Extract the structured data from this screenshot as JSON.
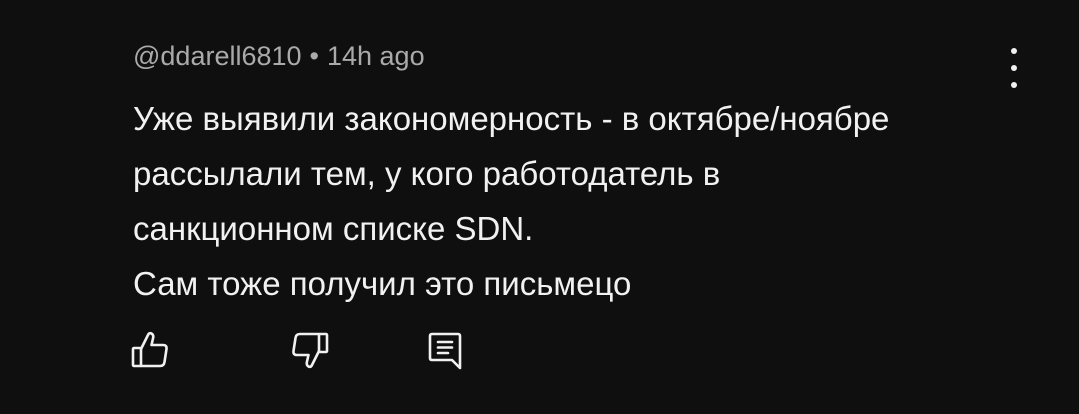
{
  "comment": {
    "author": "@ddarell6810",
    "separator": "•",
    "time": "14h ago",
    "lines": [
      "Уже выявили закономерность - в октябре/ноябре",
      "рассылали тем, у кого работодатель в",
      "санкционном списке SDN.",
      "Сам тоже получил это письмецо"
    ]
  },
  "icons": {
    "menu": "more-vertical-icon",
    "like": "thumbs-up-icon",
    "dislike": "thumbs-down-icon",
    "reply": "reply-comment-icon"
  },
  "colors": {
    "background": "#0f0f0f",
    "text": "#f1f1f1",
    "meta": "#aaaaaa"
  }
}
